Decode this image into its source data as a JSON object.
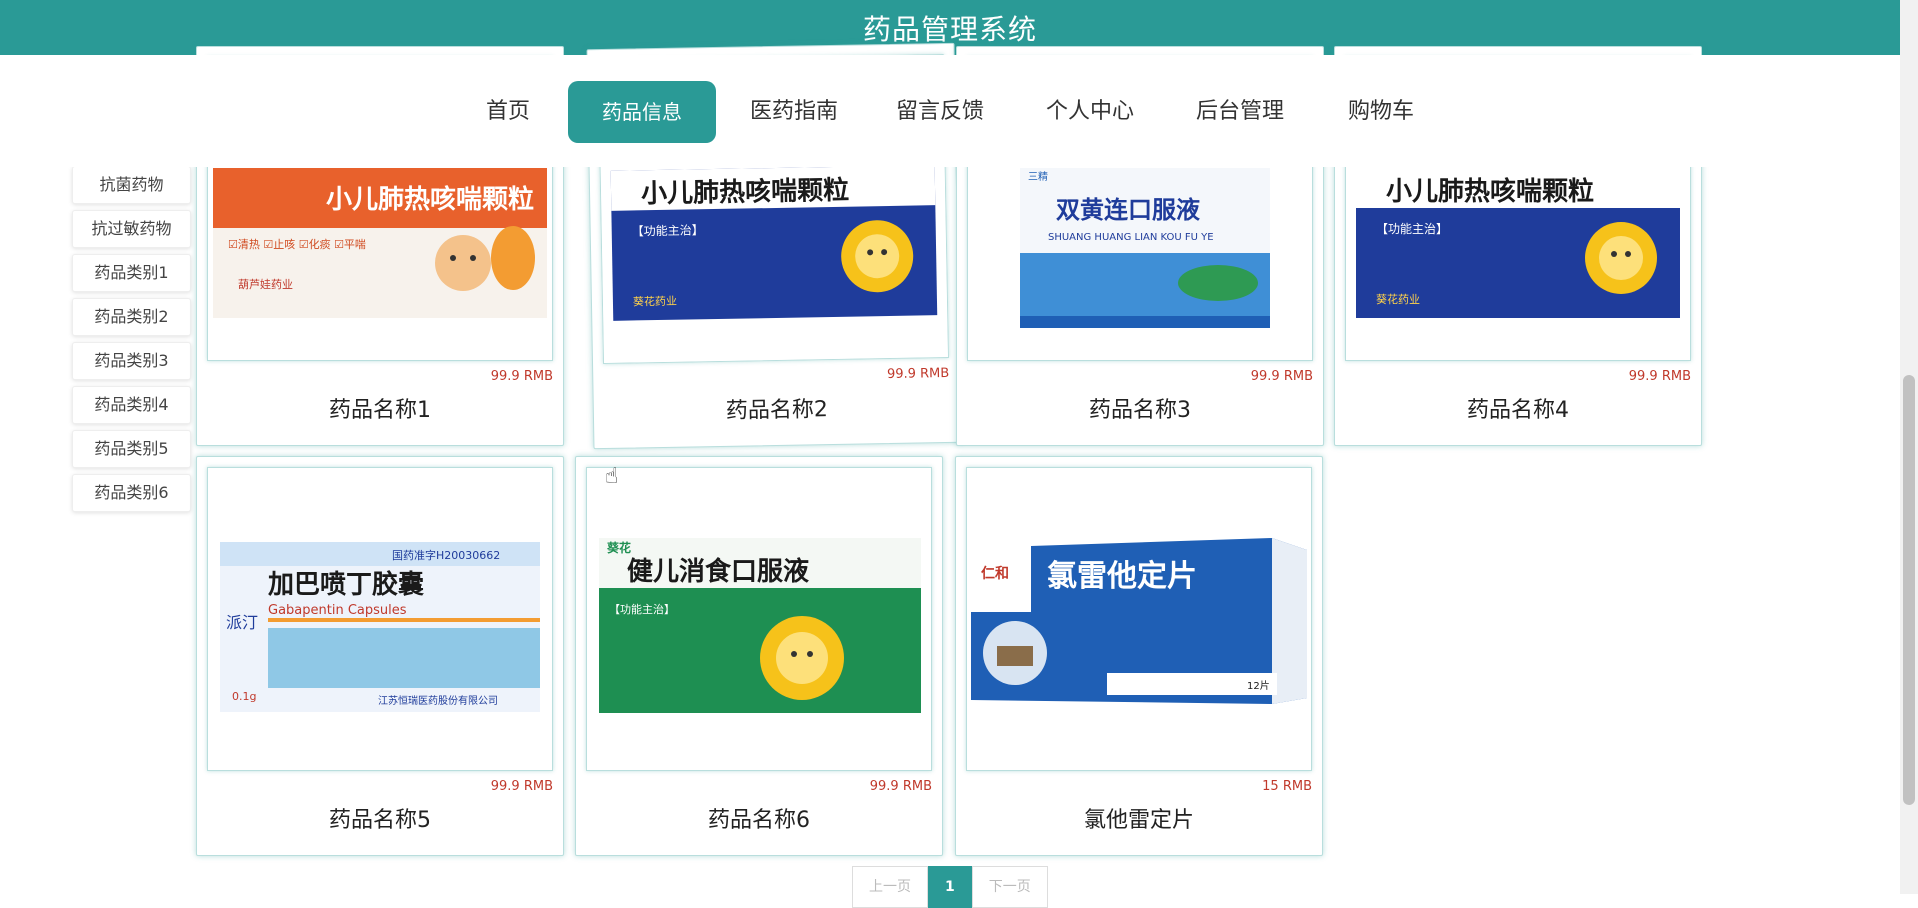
{
  "header": {
    "title": "药品管理系统"
  },
  "nav": {
    "items": [
      "首页",
      "药品信息",
      "医药指南",
      "留言反馈",
      "个人中心",
      "后台管理",
      "购物车"
    ],
    "active": "药品信息"
  },
  "sidebar": {
    "items": [
      "抗菌药物",
      "抗过敏药物",
      "药品类别1",
      "药品类别2",
      "药品类别3",
      "药品类别4",
      "药品类别5",
      "药品类别6"
    ]
  },
  "products": [
    {
      "name": "药品名称1",
      "price": "99.9 RMB",
      "box_text": "小儿肺热咳喘颗粒",
      "box_sub": "☑清热 ☑止咳 ☑化痰 ☑平喘",
      "brand": "葫芦娃药业"
    },
    {
      "name": "药品名称2",
      "price": "99.9 RMB",
      "box_text": "小儿肺热咳喘颗粒",
      "box_sub": "【功能主治】",
      "brand": "葵花药业"
    },
    {
      "name": "药品名称3",
      "price": "99.9 RMB",
      "box_text": "双黄连口服液",
      "box_sub": "SHUANG HUANG LIAN KOU FU YE",
      "brand": "三精"
    },
    {
      "name": "药品名称4",
      "price": "99.9 RMB",
      "box_text": "小儿肺热咳喘颗粒",
      "box_sub": "【功能主治】",
      "brand": "葵花药业"
    },
    {
      "name": "药品名称5",
      "price": "99.9 RMB",
      "box_text": "加巴喷丁胶囊",
      "box_sub": "Gabapentin Capsules",
      "brand": "江苏恒瑞医药股份有限公司",
      "extra": "国药准字H20030662",
      "dose": "0.1g",
      "side": "派汀"
    },
    {
      "name": "药品名称6",
      "price": "99.9 RMB",
      "box_text": "健儿消食口服液",
      "box_sub": "【功能主治】",
      "brand": "葵花"
    },
    {
      "name": "氯他雷定片",
      "price": "15 RMB",
      "box_text": "氯雷他定片",
      "box_sub": "",
      "brand": "仁和",
      "dose": "12片"
    }
  ],
  "pager": {
    "prev": "上一页",
    "current": "1",
    "next": "下一页"
  },
  "colors": {
    "primary": "#2a9a96",
    "price": "#c0392b"
  }
}
